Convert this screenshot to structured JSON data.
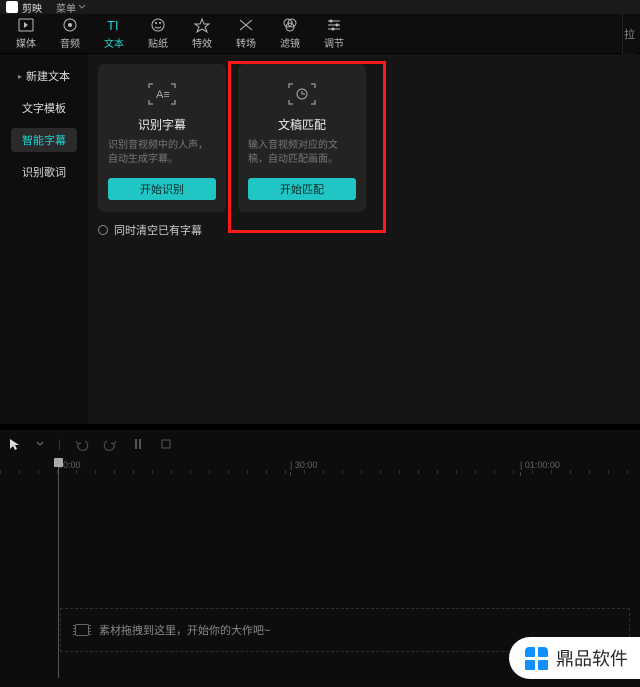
{
  "titlebar": {
    "app": "剪映",
    "menu": "菜单"
  },
  "toolbar": {
    "items": [
      {
        "label": "媒体"
      },
      {
        "label": "音频"
      },
      {
        "label": "文本"
      },
      {
        "label": "贴纸"
      },
      {
        "label": "特效"
      },
      {
        "label": "转场"
      },
      {
        "label": "滤镜"
      },
      {
        "label": "调节"
      }
    ],
    "right_hint": "拉"
  },
  "sidebar": {
    "items": [
      {
        "label": "新建文本"
      },
      {
        "label": "文字模板"
      },
      {
        "label": "智能字幕"
      },
      {
        "label": "识别歌词"
      }
    ]
  },
  "cards": [
    {
      "title": "识别字幕",
      "desc": "识别音视频中的人声，自动生成字幕。",
      "btn": "开始识别"
    },
    {
      "title": "文稿匹配",
      "desc": "输入音视频对应的文稿，自动匹配画面。",
      "btn": "开始匹配"
    }
  ],
  "clear_caption_label": "同时清空已有字幕",
  "ruler": {
    "t0": "00:00",
    "t1": "| 30:00",
    "t2": "| 01:00:00"
  },
  "track_placeholder": "素材拖拽到这里，开始你的大作吧~",
  "watermark": "鼎品软件"
}
